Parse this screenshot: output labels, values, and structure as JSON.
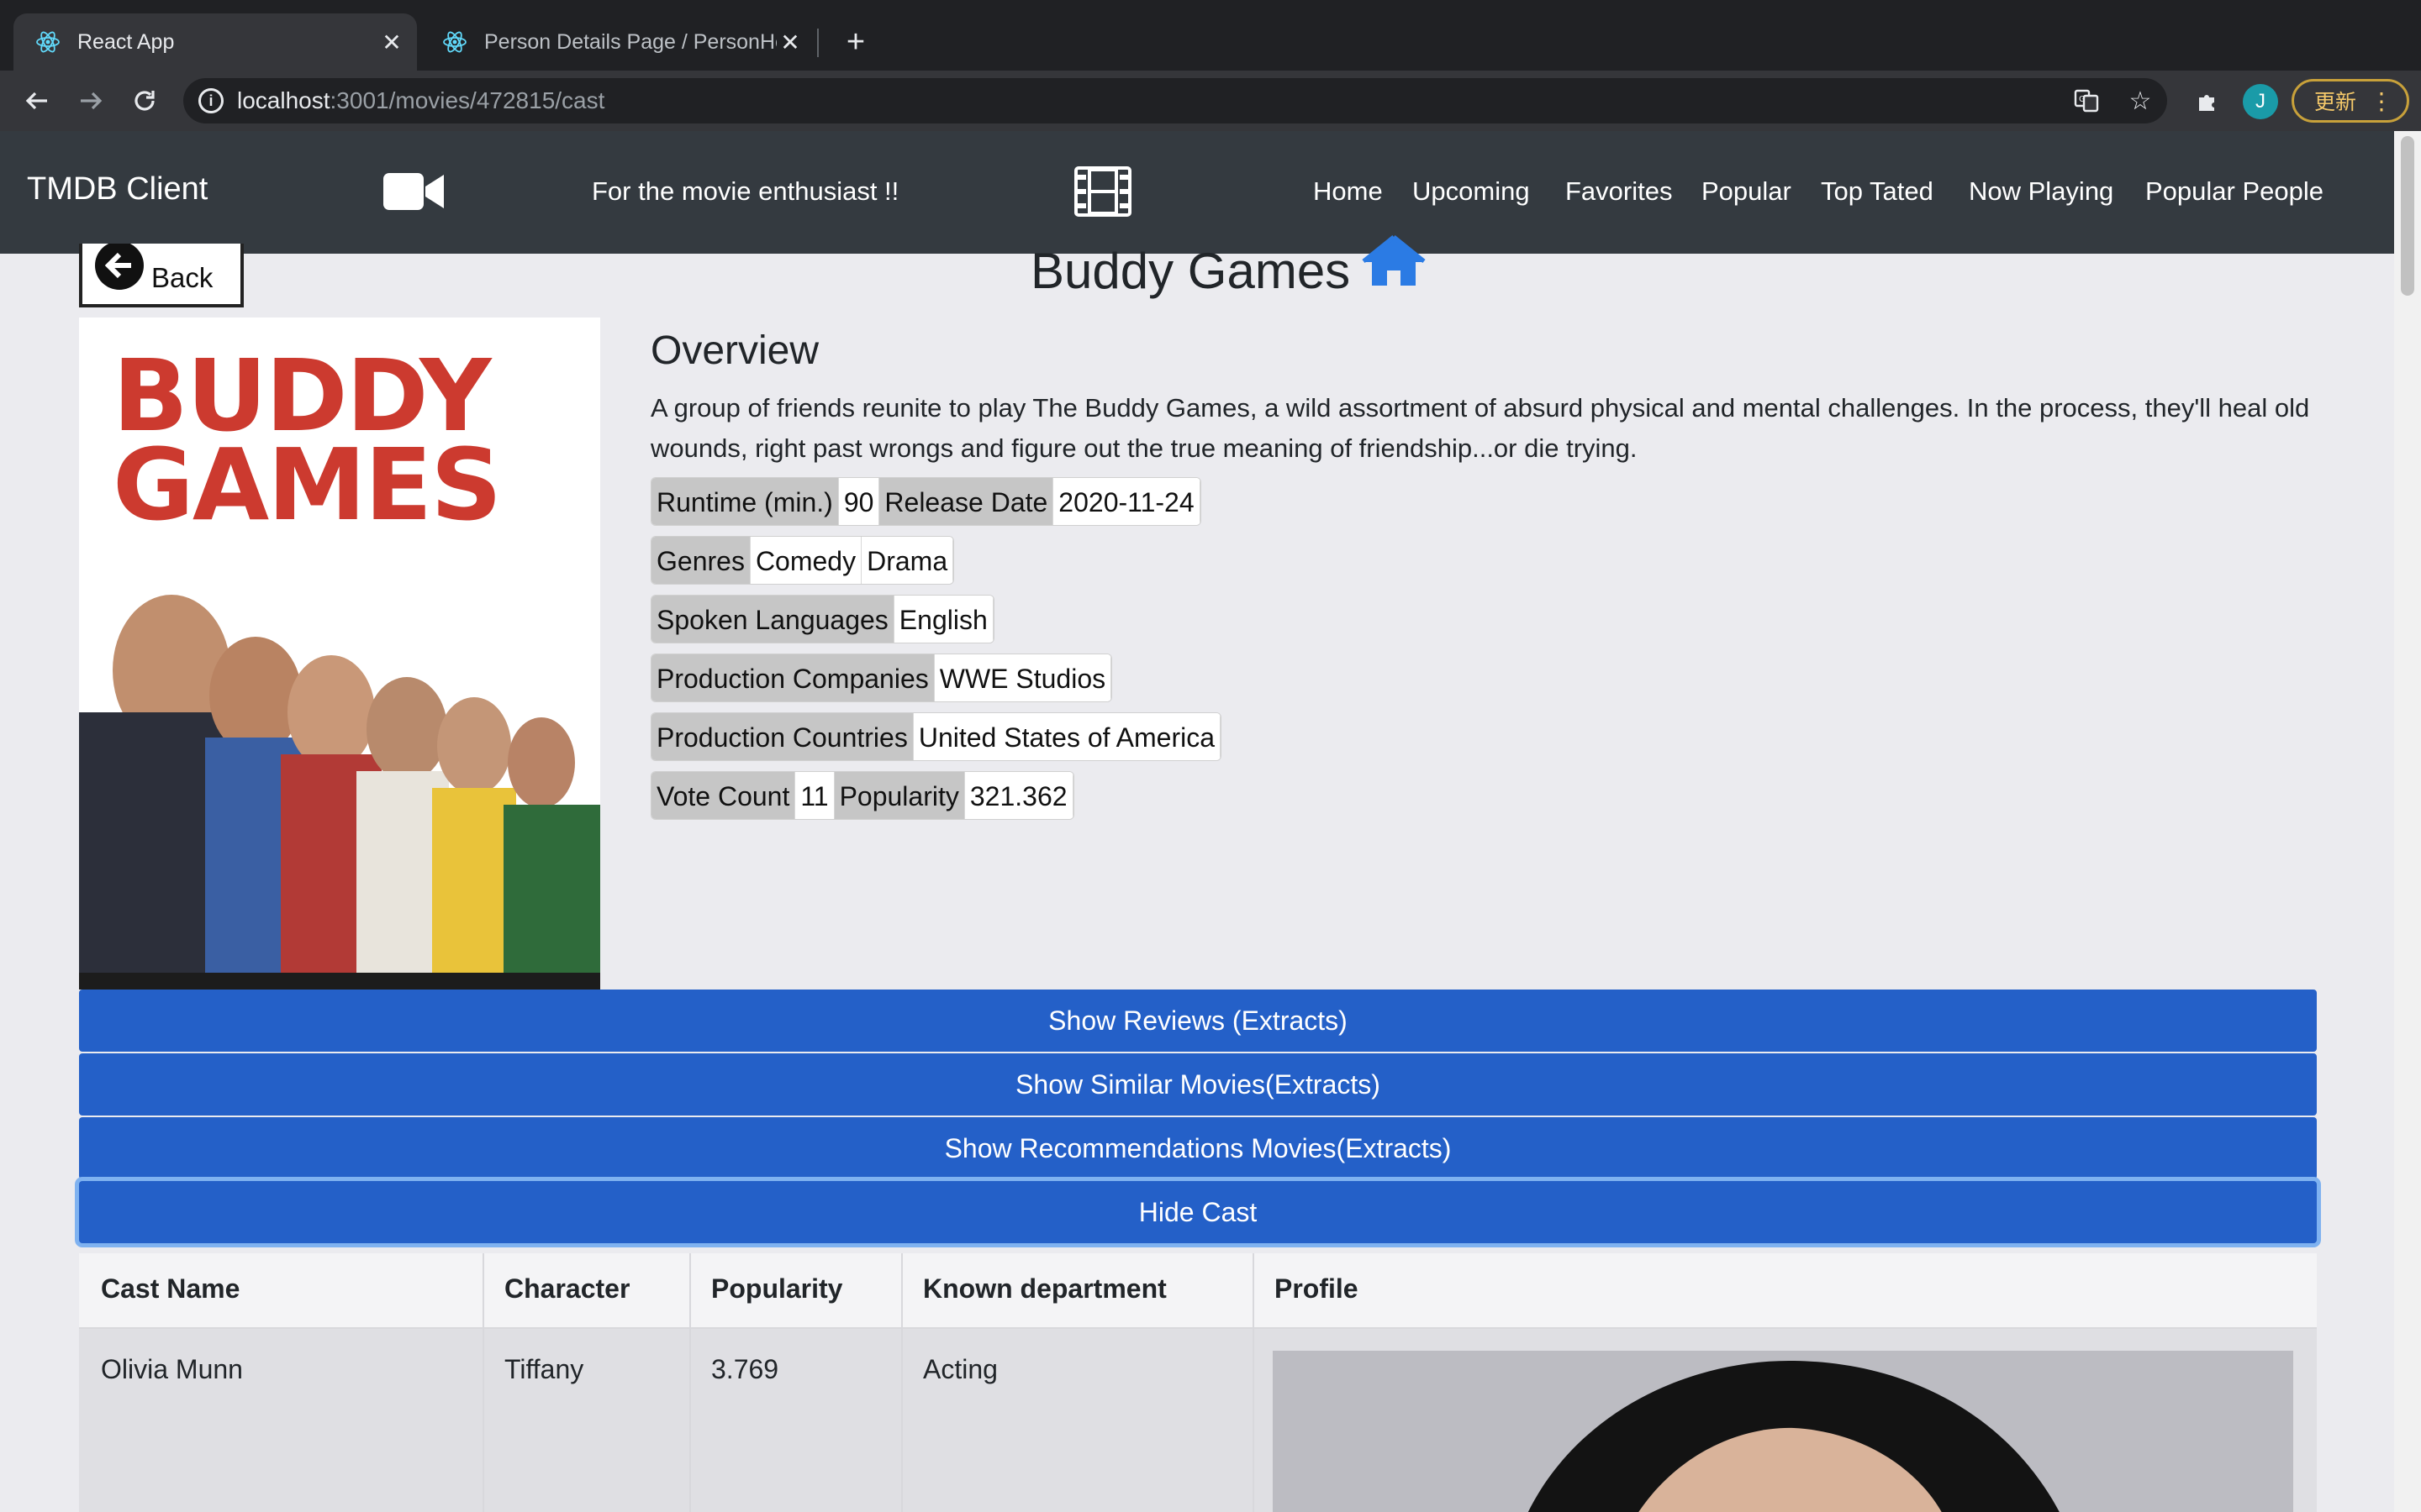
{
  "browser": {
    "tabs": [
      {
        "title": "React App",
        "active": true
      },
      {
        "title": "Person Details Page / PersonHe",
        "active": false
      }
    ],
    "url_host": "localhost",
    "url_path": ":3001/movies/472815/cast",
    "profile_initial": "J",
    "update_label": "更新"
  },
  "navbar": {
    "brand": "TMDB Client",
    "tagline": "For the movie enthusiast !!",
    "links": [
      "Home",
      "Upcoming",
      "Favorites",
      "Popular",
      "Top Tated",
      "Now Playing",
      "Popular People"
    ]
  },
  "movie": {
    "back_label": "Back",
    "title": "Buddy Games",
    "poster_text_line1": "BUDDY",
    "poster_text_line2": "GAMES",
    "overview_heading": "Overview",
    "overview": "A group of friends reunite to play The Buddy Games, a wild assortment of absurd physical and mental challenges. In the process, they'll heal old wounds, right past wrongs and figure out the true meaning of friendship...or die trying.",
    "runtime_label": "Runtime (min.)",
    "runtime": "90",
    "release_label": "Release Date",
    "release_date": "2020-11-24",
    "genres_label": "Genres",
    "genres": [
      "Comedy",
      "Drama"
    ],
    "languages_label": "Spoken Languages",
    "languages": [
      "English"
    ],
    "companies_label": "Production Companies",
    "companies": [
      "WWE Studios"
    ],
    "countries_label": "Production Countries",
    "countries": [
      "United States of America"
    ],
    "vote_count_label": "Vote Count",
    "vote_count": "11",
    "popularity_label": "Popularity",
    "popularity": "321.362"
  },
  "actions": {
    "reviews": "Show Reviews (Extracts)",
    "similar": "Show Similar Movies(Extracts)",
    "recommendations": "Show Recommendations Movies(Extracts)",
    "cast": "Hide Cast"
  },
  "cast": {
    "headers": [
      "Cast Name",
      "Character",
      "Popularity",
      "Known department",
      "Profile"
    ],
    "rows": [
      {
        "name": "Olivia Munn",
        "character": "Tiffany",
        "popularity": "3.769",
        "department": "Acting"
      }
    ]
  }
}
